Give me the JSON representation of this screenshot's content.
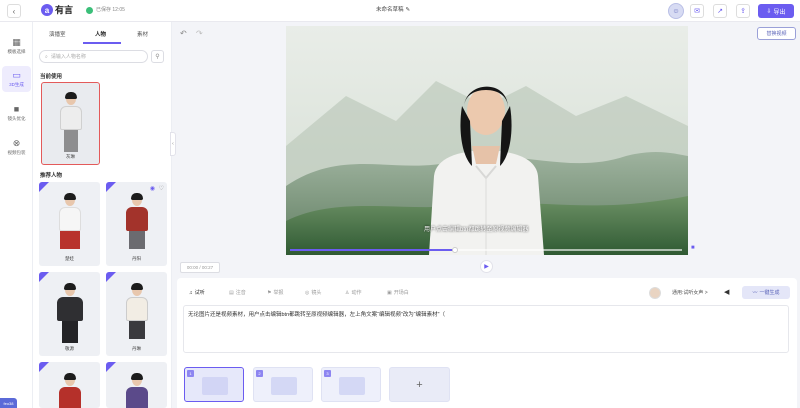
{
  "topbar": {
    "back_icon": "chevron-left-icon",
    "logo_mark": "a",
    "logo_text": "有言",
    "save_status": "已保存 12:05",
    "title": "未命名草稿",
    "edit_icon": "✎",
    "export_label": "导出",
    "icons": [
      "mail-icon",
      "share-icon",
      "upload-icon"
    ]
  },
  "rail": {
    "items": [
      {
        "label": "模板选择",
        "icon": "grid-icon",
        "glyph": "▦"
      },
      {
        "label": "3D生成",
        "icon": "screen-icon",
        "glyph": "▭"
      },
      {
        "label": "镜头优化",
        "icon": "camera-icon",
        "glyph": "■"
      },
      {
        "label": "视频包装",
        "icon": "package-icon",
        "glyph": "⊗"
      }
    ],
    "tag": "feo38"
  },
  "panel": {
    "tabs": [
      "演播室",
      "人物",
      "素材"
    ],
    "active_tab": 1,
    "search_placeholder": "请输入人物名称",
    "current_section": "当前使用",
    "current_person": "灰琳",
    "recommend_section": "推荐人物",
    "people": [
      "楚娃",
      "丹阳",
      "敬源",
      "丹琳",
      "",
      ""
    ]
  },
  "toolbar": {
    "replace_label": "替换视频"
  },
  "preview": {
    "subtitle": "用户点击编辑btn都跳转至原视频编辑器",
    "progress": 0.42,
    "timecode": "00:00 / 00:27"
  },
  "editor": {
    "tools": [
      "试听",
      "注音",
      "举报",
      "镜头",
      "动作",
      "开场白"
    ],
    "voice_name": "通用:试听女声 >",
    "mark_label": "一键生成",
    "script": "无论图片还是视频素材，用户点击编辑btn都跳转至原视频编辑器，左上角文案“编辑视频”改为“编辑素材”（",
    "scenes": [
      "1",
      "2",
      "3"
    ],
    "add_label": "+"
  },
  "colors": {
    "accent": "#6b5cf0",
    "selected_border": "#e35a5a"
  }
}
